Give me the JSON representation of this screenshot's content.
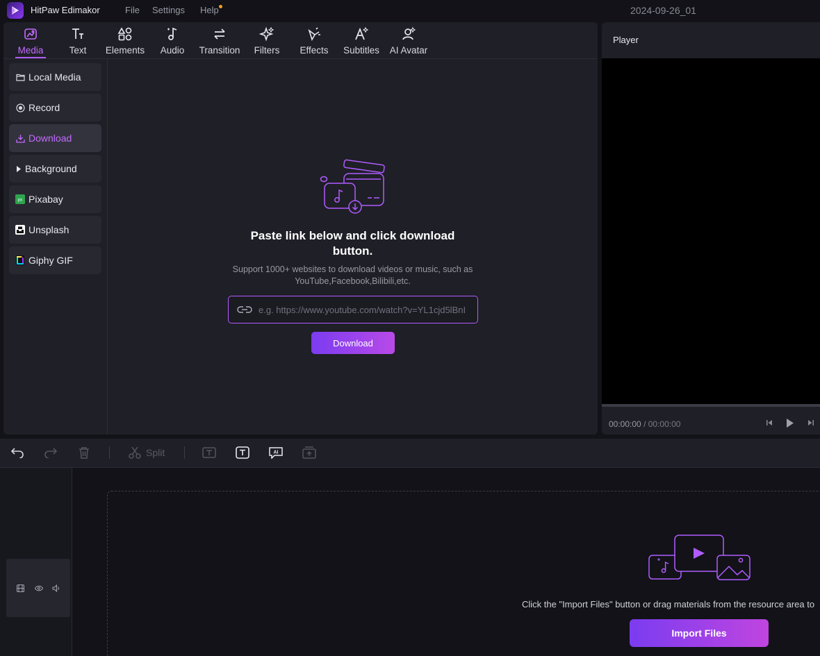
{
  "app": {
    "name": "HitPaw Edimakor",
    "project_title": "2024-09-26_01",
    "menu": [
      "File",
      "Settings",
      "Help"
    ]
  },
  "tabs": [
    {
      "label": "Media",
      "icon": "media-icon",
      "active": true
    },
    {
      "label": "Text",
      "icon": "text-icon"
    },
    {
      "label": "Elements",
      "icon": "elements-icon"
    },
    {
      "label": "Audio",
      "icon": "audio-icon"
    },
    {
      "label": "Transition",
      "icon": "transition-icon"
    },
    {
      "label": "Filters",
      "icon": "filters-icon"
    },
    {
      "label": "Effects",
      "icon": "effects-icon"
    },
    {
      "label": "Subtitles",
      "icon": "subtitles-icon"
    },
    {
      "label": "AI Avatar",
      "icon": "ai-avatar-icon"
    }
  ],
  "sidebar": {
    "items": [
      {
        "label": "Local Media",
        "icon": "folder-icon"
      },
      {
        "label": "Record",
        "icon": "record-icon"
      },
      {
        "label": "Download",
        "icon": "download-icon",
        "active": true
      },
      {
        "label": "Background",
        "icon": "caret-right-icon"
      },
      {
        "label": "Pixabay",
        "icon": "pixabay-icon"
      },
      {
        "label": "Unsplash",
        "icon": "unsplash-icon"
      },
      {
        "label": "Giphy GIF",
        "icon": "giphy-icon"
      }
    ]
  },
  "download": {
    "heading": "Paste link below and click download button.",
    "subtext": "Support 1000+ websites to download videos or music, such as YouTube,Facebook,Bilibili,etc.",
    "input_placeholder": "e.g. https://www.youtube.com/watch?v=YL1cjd5lBnI",
    "input_value": "",
    "button_label": "Download"
  },
  "player": {
    "title": "Player",
    "current_time": "00:00:00",
    "separator": "/",
    "total_time": "00:00:00"
  },
  "timeline": {
    "split_label": "Split",
    "import_hint": "Click the \"Import Files\" button or drag materials from the resource area to",
    "import_button": "Import Files"
  },
  "colors": {
    "accent": "#b05cff",
    "button_gradient_start": "#7b3cf0",
    "button_gradient_end": "#c045e0",
    "panel_bg": "#1f1f27",
    "app_bg": "#121218"
  }
}
